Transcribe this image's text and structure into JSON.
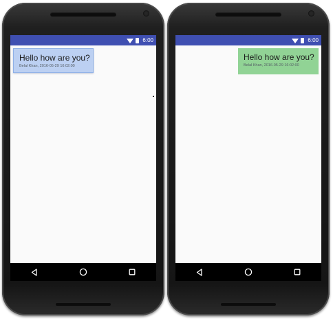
{
  "phones": [
    {
      "status_bar": {
        "time": "6:00",
        "color": "#3f4fb1"
      },
      "message": {
        "text": "Hello how are you?",
        "meta": "Belal Khan, 2016-05-29 16:02:00",
        "bubble_color": "#bcd0f2",
        "alignment": "left"
      },
      "nav": [
        "back-icon",
        "home-icon",
        "recents-icon"
      ]
    },
    {
      "status_bar": {
        "time": "6:00",
        "color": "#3f4fb1"
      },
      "message": {
        "text": "Hello how are you?",
        "meta": "Belal Khan, 2016-05-29 16:02:00",
        "bubble_color": "#91d395",
        "alignment": "right"
      },
      "nav": [
        "back-icon",
        "home-icon",
        "recents-icon"
      ]
    }
  ]
}
